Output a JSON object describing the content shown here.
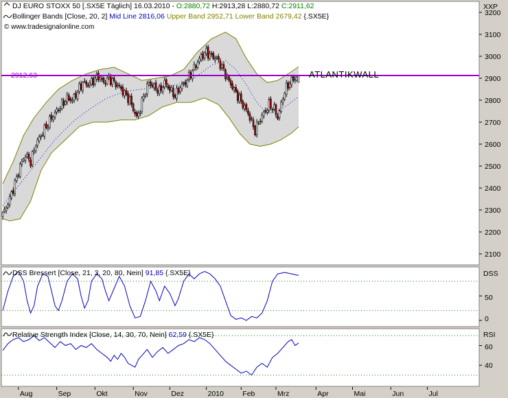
{
  "main_panel": {
    "title_parts": [
      "DJ EURO STOXX 50 [.SX5E  Täglich] 16.03.2010 - ",
      "O:2880,72",
      " H:2913,28 L:2880,72 ",
      "C:2911,62"
    ],
    "bb_parts": [
      "Bollinger Bands [Close, 20, 2] ",
      "Mid Line 2816,06",
      " Upper Band 2952,71 Lower Band 2679,42",
      " {.SX5E}"
    ],
    "copyright": "© www.tradesignalonline.com",
    "axis_label": "XXP",
    "hline_label": "2912,63",
    "annotation": "ATLANTIKWALL"
  },
  "dss_panel": {
    "title_parts": [
      "DSS Bressert [Close, 21, 3, 20, 80, Nein] ",
      "91,85",
      " {.SX5E}"
    ],
    "axis_label": "DSS",
    "ticks": [
      "50",
      "0"
    ]
  },
  "rsi_panel": {
    "title_parts": [
      "Relative Strength Index [Close, 14, 30, 70, Nein] ",
      "62,59",
      " {.SX5E}"
    ],
    "axis_label": "RSI",
    "ticks": [
      "60",
      "40"
    ]
  },
  "colors": {
    "up_candle": "#ffffff",
    "down_candle": "#c00000",
    "band": "#808000",
    "band_fill": "#d9d9d9",
    "mid_line": "#0000c0",
    "hline": "#9900cc",
    "indicator": "#0000c0",
    "dotted_guide": "#008000"
  },
  "chart_data": [
    {
      "type": "candlestick",
      "title": "DJ EURO STOXX 50 [.SX5E  Täglich] 16.03.2010",
      "ylim": [
        2050,
        3250
      ],
      "y_ticks": [
        2100,
        2200,
        2300,
        2400,
        2500,
        2600,
        2700,
        2800,
        2900,
        3000,
        3100,
        3200
      ],
      "x_ticks": [
        "Aug",
        "Sep",
        "Okt",
        "Nov",
        "Dez",
        "2010",
        "Feb",
        "Mrz",
        "Apr",
        "Mai",
        "Jun",
        "Jul"
      ],
      "x_tick_index": [
        9,
        31,
        53,
        75,
        96,
        117,
        137,
        157,
        180,
        201,
        223,
        244
      ],
      "horizontal_line": 2912.63,
      "close_path": [
        [
          0,
          2280
        ],
        [
          3,
          2330
        ],
        [
          7,
          2420
        ],
        [
          10,
          2500
        ],
        [
          13,
          2550
        ],
        [
          16,
          2520
        ],
        [
          19,
          2600
        ],
        [
          22,
          2640
        ],
        [
          25,
          2680
        ],
        [
          28,
          2720
        ],
        [
          31,
          2750
        ],
        [
          34,
          2780
        ],
        [
          37,
          2810
        ],
        [
          40,
          2800
        ],
        [
          43,
          2840
        ],
        [
          46,
          2880
        ],
        [
          49,
          2870
        ],
        [
          52,
          2890
        ],
        [
          55,
          2910
        ],
        [
          58,
          2880
        ],
        [
          61,
          2900
        ],
        [
          64,
          2880
        ],
        [
          67,
          2860
        ],
        [
          70,
          2830
        ],
        [
          73,
          2800
        ],
        [
          75,
          2760
        ],
        [
          77,
          2720
        ],
        [
          79,
          2760
        ],
        [
          81,
          2820
        ],
        [
          84,
          2880
        ],
        [
          87,
          2860
        ],
        [
          90,
          2840
        ],
        [
          93,
          2880
        ],
        [
          96,
          2850
        ],
        [
          99,
          2820
        ],
        [
          102,
          2860
        ],
        [
          105,
          2880
        ],
        [
          108,
          2920
        ],
        [
          111,
          2960
        ],
        [
          114,
          3000
        ],
        [
          117,
          3020
        ],
        [
          120,
          3000
        ],
        [
          123,
          2990
        ],
        [
          126,
          2950
        ],
        [
          129,
          2900
        ],
        [
          132,
          2860
        ],
        [
          135,
          2820
        ],
        [
          138,
          2780
        ],
        [
          141,
          2740
        ],
        [
          143,
          2700
        ],
        [
          145,
          2660
        ],
        [
          147,
          2700
        ],
        [
          150,
          2740
        ],
        [
          153,
          2780
        ],
        [
          156,
          2760
        ],
        [
          158,
          2720
        ],
        [
          160,
          2780
        ],
        [
          162,
          2840
        ],
        [
          164,
          2870
        ],
        [
          166,
          2890
        ],
        [
          168,
          2900
        ],
        [
          170,
          2911.62
        ]
      ],
      "candles": [
        {
          "x": 170,
          "open": 2880.72,
          "high": 2913.28,
          "low": 2880.72,
          "close": 2911.62
        }
      ],
      "series": [
        {
          "name": "Upper Band",
          "values": [
            [
              0,
              2420
            ],
            [
              6,
              2520
            ],
            [
              12,
              2640
            ],
            [
              18,
              2720
            ],
            [
              25,
              2790
            ],
            [
              32,
              2850
            ],
            [
              40,
              2890
            ],
            [
              48,
              2920
            ],
            [
              56,
              2940
            ],
            [
              64,
              2950
            ],
            [
              72,
              2920
            ],
            [
              80,
              2890
            ],
            [
              88,
              2900
            ],
            [
              96,
              2910
            ],
            [
              104,
              2940
            ],
            [
              112,
              3020
            ],
            [
              120,
              3080
            ],
            [
              128,
              3110
            ],
            [
              134,
              3080
            ],
            [
              140,
              2990
            ],
            [
              146,
              2920
            ],
            [
              152,
              2880
            ],
            [
              158,
              2890
            ],
            [
              164,
              2920
            ],
            [
              170,
              2952.71
            ]
          ]
        },
        {
          "name": "Mid Line",
          "values": [
            [
              0,
              2320
            ],
            [
              10,
              2420
            ],
            [
              20,
              2520
            ],
            [
              30,
              2620
            ],
            [
              40,
              2700
            ],
            [
              50,
              2760
            ],
            [
              60,
              2810
            ],
            [
              70,
              2840
            ],
            [
              80,
              2850
            ],
            [
              90,
              2860
            ],
            [
              100,
              2870
            ],
            [
              110,
              2900
            ],
            [
              120,
              2960
            ],
            [
              128,
              2980
            ],
            [
              134,
              2940
            ],
            [
              140,
              2870
            ],
            [
              146,
              2790
            ],
            [
              152,
              2740
            ],
            [
              158,
              2750
            ],
            [
              164,
              2780
            ],
            [
              170,
              2816.06
            ]
          ]
        },
        {
          "name": "Lower Band",
          "values": [
            [
              0,
              2260
            ],
            [
              4,
              2250
            ],
            [
              10,
              2260
            ],
            [
              16,
              2340
            ],
            [
              22,
              2480
            ],
            [
              28,
              2560
            ],
            [
              36,
              2620
            ],
            [
              44,
              2680
            ],
            [
              52,
              2700
            ],
            [
              60,
              2700
            ],
            [
              68,
              2710
            ],
            [
              76,
              2710
            ],
            [
              84,
              2730
            ],
            [
              92,
              2770
            ],
            [
              100,
              2790
            ],
            [
              108,
              2790
            ],
            [
              116,
              2810
            ],
            [
              124,
              2780
            ],
            [
              130,
              2720
            ],
            [
              136,
              2650
            ],
            [
              142,
              2600
            ],
            [
              148,
              2590
            ],
            [
              154,
              2600
            ],
            [
              160,
              2620
            ],
            [
              166,
              2650
            ],
            [
              170,
              2679.42
            ]
          ]
        }
      ],
      "annotations": [
        "2912,63",
        "ATLANTIKWALL"
      ]
    },
    {
      "type": "line",
      "title": "DSS Bressert [Close, 21, 3, 20, 80, Nein]",
      "ylim": [
        -10,
        105
      ],
      "y_ticks": [
        0,
        50
      ],
      "guides": [
        20,
        80
      ],
      "series": [
        {
          "name": "DSS Bressert",
          "values": [
            [
              0,
              20
            ],
            [
              3,
              60
            ],
            [
              6,
              90
            ],
            [
              9,
              100
            ],
            [
              12,
              80
            ],
            [
              14,
              40
            ],
            [
              16,
              15
            ],
            [
              18,
              30
            ],
            [
              20,
              70
            ],
            [
              23,
              95
            ],
            [
              26,
              90
            ],
            [
              28,
              60
            ],
            [
              30,
              30
            ],
            [
              32,
              20
            ],
            [
              34,
              40
            ],
            [
              37,
              80
            ],
            [
              40,
              95
            ],
            [
              43,
              85
            ],
            [
              45,
              50
            ],
            [
              47,
              25
            ],
            [
              49,
              40
            ],
            [
              51,
              80
            ],
            [
              54,
              95
            ],
            [
              57,
              85
            ],
            [
              59,
              60
            ],
            [
              61,
              40
            ],
            [
              64,
              65
            ],
            [
              67,
              90
            ],
            [
              70,
              70
            ],
            [
              73,
              30
            ],
            [
              76,
              5
            ],
            [
              79,
              8
            ],
            [
              82,
              40
            ],
            [
              85,
              80
            ],
            [
              88,
              60
            ],
            [
              90,
              40
            ],
            [
              93,
              70
            ],
            [
              96,
              55
            ],
            [
              99,
              30
            ],
            [
              101,
              45
            ],
            [
              104,
              80
            ],
            [
              107,
              95
            ],
            [
              110,
              85
            ],
            [
              113,
              95
            ],
            [
              116,
              100
            ],
            [
              119,
              95
            ],
            [
              122,
              85
            ],
            [
              125,
              70
            ],
            [
              128,
              40
            ],
            [
              131,
              10
            ],
            [
              134,
              2
            ],
            [
              137,
              5
            ],
            [
              140,
              0
            ],
            [
              143,
              8
            ],
            [
              146,
              5
            ],
            [
              149,
              15
            ],
            [
              152,
              40
            ],
            [
              155,
              80
            ],
            [
              158,
              95
            ],
            [
              162,
              98
            ],
            [
              166,
              95
            ],
            [
              170,
              91.85
            ]
          ]
        }
      ]
    },
    {
      "type": "line",
      "title": "Relative Strength Index [Close, 14, 30, 70, Nein]",
      "ylim": [
        20,
        75
      ],
      "y_ticks": [
        40,
        60
      ],
      "guides": [
        30,
        70
      ],
      "series": [
        {
          "name": "Relative Strength Index",
          "values": [
            [
              0,
              55
            ],
            [
              3,
              62
            ],
            [
              6,
              66
            ],
            [
              9,
              68
            ],
            [
              12,
              64
            ],
            [
              15,
              66
            ],
            [
              18,
              70
            ],
            [
              21,
              65
            ],
            [
              24,
              68
            ],
            [
              27,
              63
            ],
            [
              30,
              58
            ],
            [
              33,
              64
            ],
            [
              36,
              60
            ],
            [
              39,
              62
            ],
            [
              42,
              56
            ],
            [
              45,
              60
            ],
            [
              48,
              58
            ],
            [
              51,
              62
            ],
            [
              54,
              56
            ],
            [
              57,
              52
            ],
            [
              60,
              48
            ],
            [
              62,
              44
            ],
            [
              64,
              50
            ],
            [
              66,
              46
            ],
            [
              68,
              52
            ],
            [
              70,
              48
            ],
            [
              72,
              42
            ],
            [
              74,
              40
            ],
            [
              76,
              38
            ],
            [
              78,
              46
            ],
            [
              80,
              50
            ],
            [
              83,
              56
            ],
            [
              86,
              48
            ],
            [
              89,
              54
            ],
            [
              92,
              58
            ],
            [
              95,
              52
            ],
            [
              98,
              56
            ],
            [
              101,
              60
            ],
            [
              104,
              62
            ],
            [
              107,
              66
            ],
            [
              110,
              64
            ],
            [
              113,
              68
            ],
            [
              116,
              66
            ],
            [
              119,
              62
            ],
            [
              122,
              56
            ],
            [
              125,
              50
            ],
            [
              128,
              44
            ],
            [
              131,
              40
            ],
            [
              134,
              36
            ],
            [
              137,
              32
            ],
            [
              140,
              34
            ],
            [
              143,
              30
            ],
            [
              146,
              38
            ],
            [
              149,
              42
            ],
            [
              152,
              38
            ],
            [
              155,
              48
            ],
            [
              158,
              52
            ],
            [
              161,
              58
            ],
            [
              164,
              64
            ],
            [
              166,
              66
            ],
            [
              168,
              60
            ],
            [
              170,
              62.59
            ]
          ]
        }
      ]
    }
  ]
}
